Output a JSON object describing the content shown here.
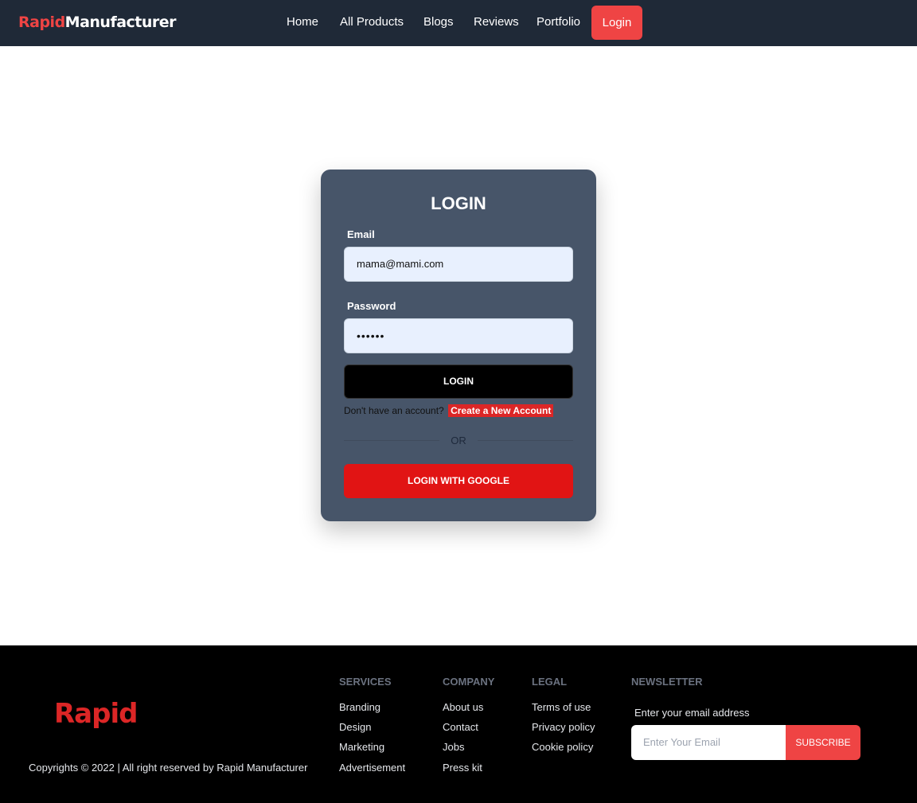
{
  "nav": {
    "brand_red": "Rapid",
    "brand_white": "Manufacturer",
    "items": [
      "Home",
      "All Products",
      "Blogs",
      "Reviews",
      "Portfolio"
    ],
    "login": "Login"
  },
  "login_form": {
    "title": "LOGIN",
    "email_label": "Email",
    "email_value": "mama@mami.com",
    "password_label": "Password",
    "password_value": "••••••",
    "submit_label": "LOGIN",
    "signup_prompt": "Don't have an account?",
    "signup_link": "Create a New Account",
    "divider_text": "OR",
    "google_label": "LOGIN WITH GOOGLE"
  },
  "footer": {
    "logo": "Rapid",
    "copyright": "Copyrights © 2022 | All right reserved by Rapid Manufacturer",
    "services": {
      "heading": "SERVICES",
      "links": [
        "Branding",
        "Design",
        "Marketing",
        "Advertisement"
      ]
    },
    "company": {
      "heading": "COMPANY",
      "links": [
        "About us",
        "Contact",
        "Jobs",
        "Press kit"
      ]
    },
    "legal": {
      "heading": "LEGAL",
      "links": [
        "Terms of use",
        "Privacy policy",
        "Cookie policy"
      ]
    },
    "newsletter": {
      "heading": "NEWSLETTER",
      "label": "Enter your email address",
      "placeholder": "Enter Your Email",
      "button": "SUBSCRIBE"
    }
  },
  "colors": {
    "navbar_bg": "#1f2937",
    "accent": "#ef4444",
    "card_bg": "#475569",
    "google_btn": "#e11414",
    "footer_bg": "#000000"
  }
}
